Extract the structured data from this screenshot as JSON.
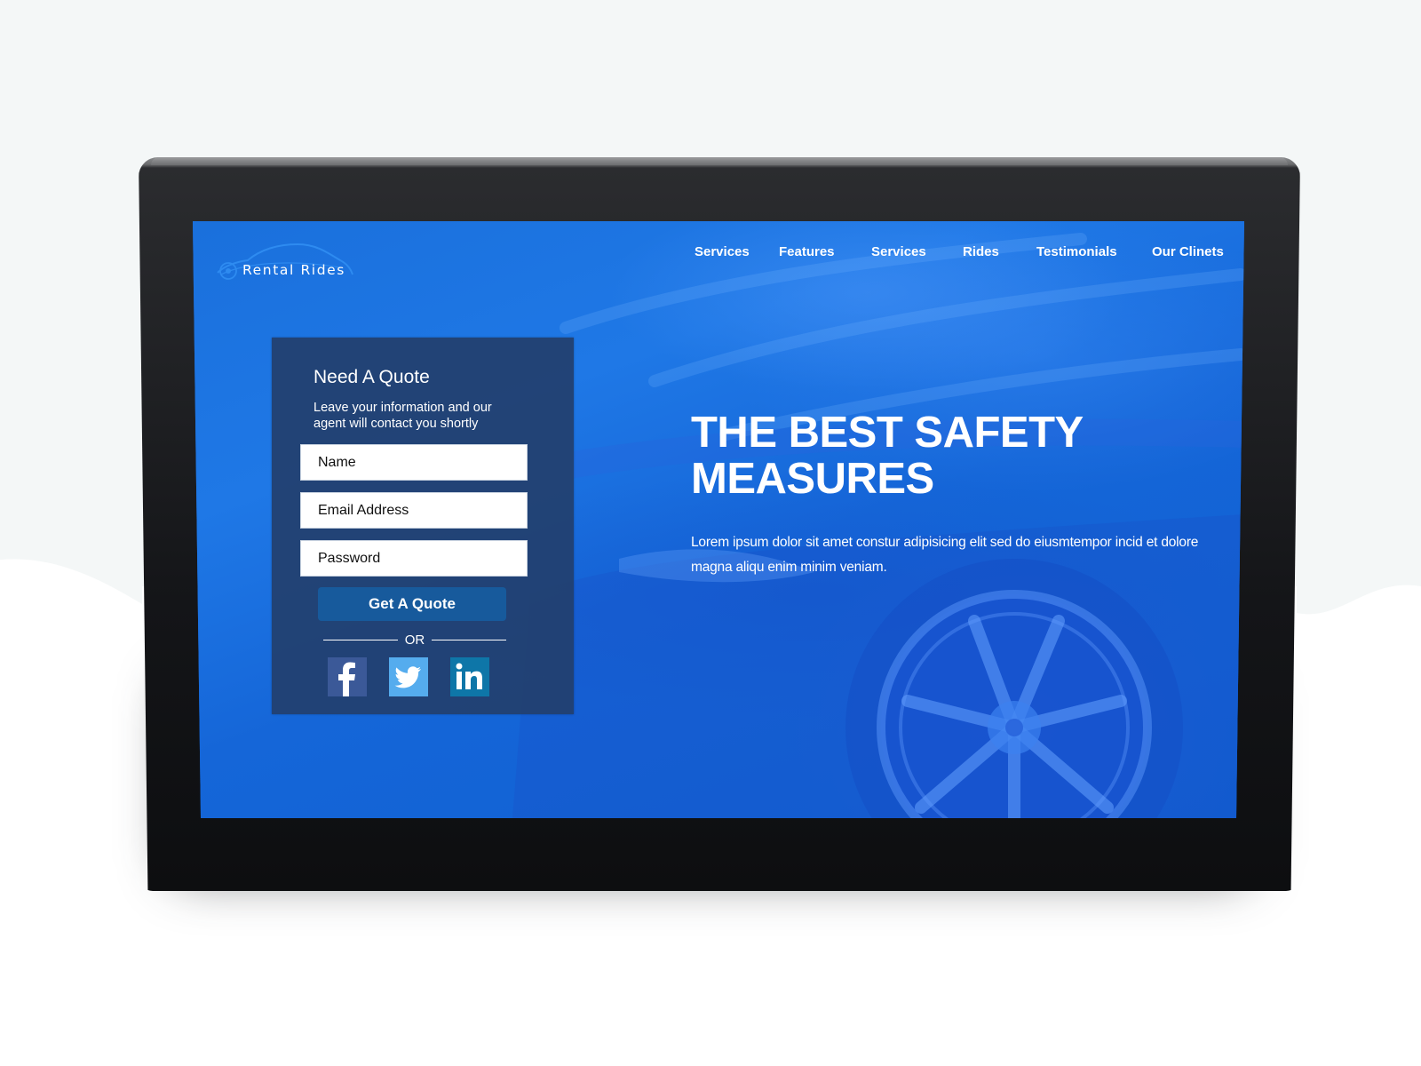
{
  "site": {
    "logo_text": "Rental Rides"
  },
  "nav": {
    "items": [
      {
        "label": "Services"
      },
      {
        "label": "Features"
      },
      {
        "label": "Services"
      },
      {
        "label": "Rides"
      },
      {
        "label": "Testimonials"
      },
      {
        "label": "Our Clinets"
      }
    ]
  },
  "quote_form": {
    "title": "Need A Quote",
    "subtitle": "Leave your information and our agent will contact you shortly",
    "fields": {
      "name_placeholder": "Name",
      "email_placeholder": "Email Address",
      "password_placeholder": "Password"
    },
    "submit_label": "Get A Quote",
    "divider_label": "OR",
    "social": [
      {
        "name": "facebook",
        "icon": "facebook-icon",
        "color": "#3b5998"
      },
      {
        "name": "twitter",
        "icon": "twitter-icon",
        "color": "#55acee"
      },
      {
        "name": "linkedin",
        "icon": "linkedin-icon",
        "color": "#0e76a8"
      }
    ]
  },
  "hero": {
    "title_line1": "THE BEST SAFETY",
    "title_line2": "MEASURES",
    "text": "Lorem ipsum dolor sit amet constur adipisicing elit sed do eiusmtempor incid et dolore magna aliqu enim minim veniam."
  },
  "colors": {
    "screen_blue": "#1466d6",
    "panel_navy": "#22406e",
    "button_blue": "#175a9c",
    "device_black": "#0d0e10",
    "backdrop_grey": "#f4f7f7"
  }
}
